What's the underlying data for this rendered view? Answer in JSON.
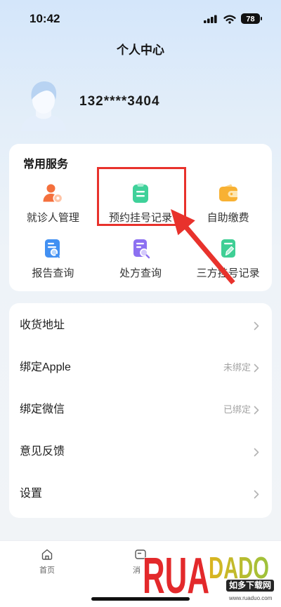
{
  "status_bar": {
    "time": "10:42",
    "battery": "78"
  },
  "header": {
    "title": "个人中心"
  },
  "profile": {
    "phone": "132****3404",
    "avatar_icon": "default-avatar-icon"
  },
  "services": {
    "title": "常用服务",
    "items": [
      {
        "label": "就诊人管理",
        "icon": "patient-management-icon",
        "color": "#f4703d"
      },
      {
        "label": "预约挂号记录",
        "icon": "clipboard-icon",
        "color": "#3fd19a"
      },
      {
        "label": "自助缴费",
        "icon": "wallet-icon",
        "color": "#f8b133"
      },
      {
        "label": "报告查询",
        "icon": "report-search-icon",
        "color": "#4290f2"
      },
      {
        "label": "处方查询",
        "icon": "prescription-search-icon",
        "color": "#8c70f1"
      },
      {
        "label": "三方挂号记录",
        "icon": "document-edit-icon",
        "color": "#3fcf95"
      }
    ]
  },
  "menu": {
    "items": [
      {
        "label": "收货地址",
        "status": ""
      },
      {
        "label": "绑定Apple",
        "status": "未绑定"
      },
      {
        "label": "绑定微信",
        "status": "已绑定"
      },
      {
        "label": "意见反馈",
        "status": ""
      },
      {
        "label": "设置",
        "status": ""
      }
    ]
  },
  "tabbar": {
    "items": [
      {
        "label": "首页",
        "icon": "home-icon"
      },
      {
        "label": "消",
        "icon": "message-icon"
      }
    ]
  },
  "annotation": {
    "color": "#e8322c"
  },
  "watermark": {
    "logo_left": "RUA",
    "logo_right": "DADO",
    "name": "如多下载网",
    "url": "www.ruaduo.com",
    "colors": [
      "#e3292b",
      "#dcb41f",
      "#9cc23c"
    ]
  }
}
